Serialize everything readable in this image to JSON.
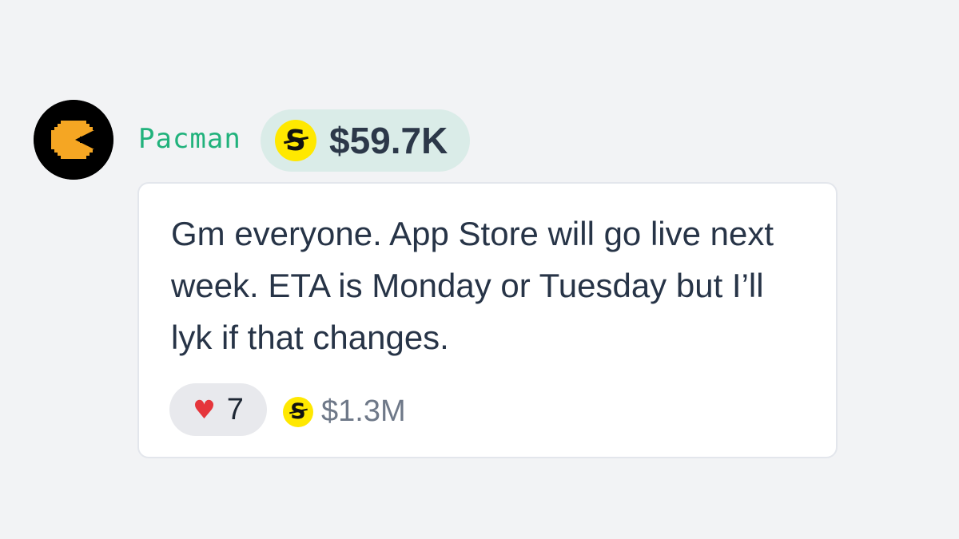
{
  "post": {
    "username": "Pacman",
    "avatar_icon": "pacman-icon",
    "balance": "$59.7K",
    "message": "Gm everyone. App Store will go live next week. ETA is Monday or Tuesday but I’ll lyk if that changes.",
    "reaction": {
      "icon": "heart-icon",
      "count": "7"
    },
    "tip_total": "$1.3M"
  },
  "colors": {
    "username": "#21b27c",
    "balance_pill_bg": "#daece8",
    "coin": "#ffe800",
    "heart": "#e5353b",
    "background": "#f2f3f5"
  }
}
